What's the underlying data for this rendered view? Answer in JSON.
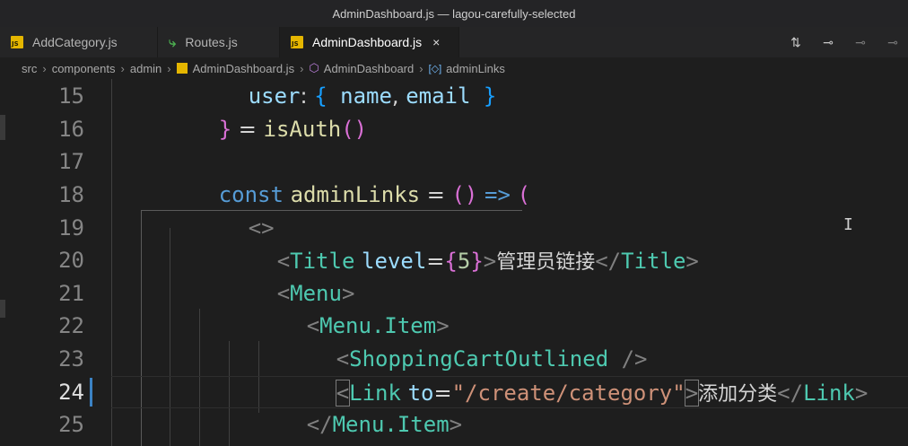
{
  "window": {
    "title": "AdminDashboard.js — lagou-carefully-selected"
  },
  "tabs": [
    {
      "label": "AddCategory.js",
      "icon": "js-file-icon",
      "badge": "JS"
    },
    {
      "label": "Routes.js",
      "icon": "react-routes-icon"
    },
    {
      "label": "AdminDashboard.js",
      "icon": "js-file-icon",
      "badge": "JS",
      "close": "×"
    }
  ],
  "breadcrumb": {
    "parts": [
      "src",
      "components",
      "admin",
      "AdminDashboard.js",
      "AdminDashboard",
      "adminLinks"
    ]
  },
  "editor": {
    "active_line": 24,
    "line_numbers": [
      "15",
      "16",
      "17",
      "18",
      "19",
      "20",
      "21",
      "22",
      "23",
      "24",
      "25"
    ],
    "lines": {
      "l15": {
        "t1": "user",
        "t2": ": ",
        "t3": "{",
        "t4": " name",
        "t5": ", ",
        "t6": "email",
        "t7": " }"
      },
      "l16": {
        "t1": "}",
        "t2": " = ",
        "t3": "isAuth",
        "t4": "()"
      },
      "l18": {
        "t1": "const",
        "t2": " ",
        "t3": "adminLinks",
        "t4": " = ",
        "t5": "()",
        "t6": " ",
        "t7": "=>",
        "t8": " ",
        "t9": "("
      },
      "l19": {
        "t1": "<>"
      },
      "l20": {
        "t1": "<",
        "t2": "Title",
        "t3": " ",
        "t4": "level",
        "t5": "=",
        "t6": "{",
        "t7": "5",
        "t8": "}",
        "t9": ">",
        "t10": "管理员链接",
        "t11": "</",
        "t12": "Title",
        "t13": ">"
      },
      "l21": {
        "t1": "<",
        "t2": "Menu",
        "t3": ">"
      },
      "l22": {
        "t1": "<",
        "t2": "Menu.Item",
        "t3": ">"
      },
      "l23": {
        "t1": "<",
        "t2": "ShoppingCartOutlined",
        "t3": " />"
      },
      "l24": {
        "t1": "<",
        "t2": "Link",
        "t3": " ",
        "t4": "to",
        "t5": "=",
        "t6": "\"/create/category\"",
        "t7": ">",
        "t8": "添加分类",
        "t9": "</",
        "t10": "Link",
        "t11": ">"
      },
      "l25": {
        "t1": "</",
        "t2": "Menu.Item",
        "t3": ">"
      }
    }
  },
  "cursor": "I",
  "colors": {
    "keyword": "#569cd6",
    "tag": "#4ec9b0",
    "string": "#ce9178",
    "bracket1": "#da70d6",
    "bracket2": "#179fff",
    "bracket3": "#ffd700"
  }
}
